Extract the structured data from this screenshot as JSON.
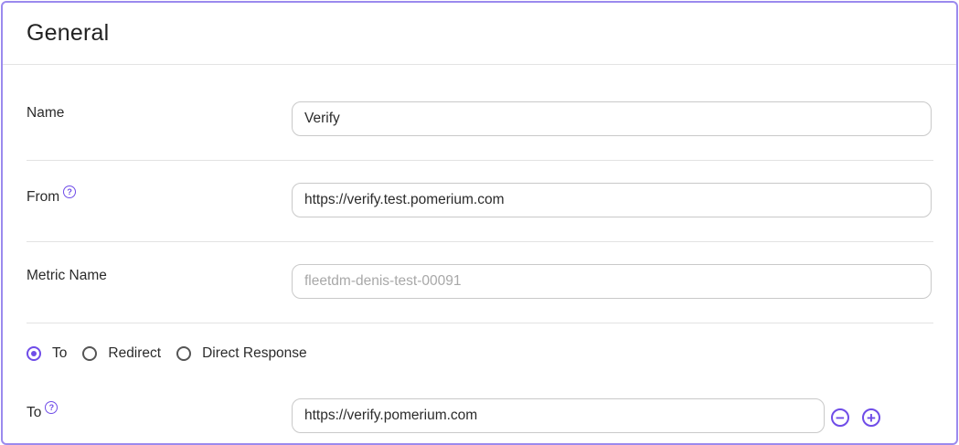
{
  "section": {
    "title": "General"
  },
  "fields": {
    "name": {
      "label": "Name",
      "value": "Verify"
    },
    "from": {
      "label": "From",
      "value": "https://verify.test.pomerium.com"
    },
    "metric_name": {
      "label": "Metric Name",
      "placeholder": "fleetdm-denis-test-00091"
    },
    "to": {
      "label": "To",
      "value": "https://verify.pomerium.com"
    }
  },
  "route_type": {
    "selected": "To",
    "options": [
      "To",
      "Redirect",
      "Direct Response"
    ]
  },
  "help_icon": "?",
  "buttons": {
    "remove": "−",
    "add": "+"
  },
  "colors": {
    "accent": "#6f4ce8",
    "border": "#9b8aee"
  }
}
